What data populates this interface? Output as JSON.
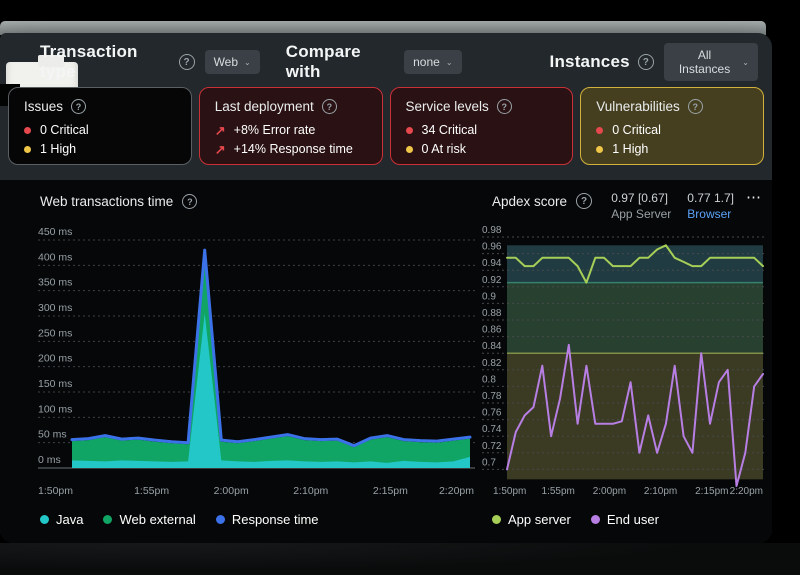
{
  "toolbar": {
    "transaction_type_label": "Transaction type",
    "transaction_type_value": "Web",
    "compare_with_label": "Compare with",
    "compare_with_value": "none",
    "instances_label": "Instances",
    "instances_value": "All Instances",
    "caret": "⌄",
    "help_glyph": "?"
  },
  "colors": {
    "critical": "#e5484d",
    "warning": "#f0c649",
    "link": "#5ba2f7"
  },
  "cards": [
    {
      "title": "Issues",
      "items": [
        {
          "text": "0 Critical",
          "color": "#e5484d"
        },
        {
          "text": "1 High",
          "color": "#f0c649"
        }
      ]
    },
    {
      "title": "Last deployment",
      "trend_glyph": "↗",
      "items": [
        {
          "text": "+8% Error rate",
          "color": "#e5484d"
        },
        {
          "text": "+14% Response time",
          "color": "#e5484d"
        }
      ]
    },
    {
      "title": "Service levels",
      "items": [
        {
          "text": "34 Critical",
          "color": "#e5484d"
        },
        {
          "text": "0 At risk",
          "color": "#f0c649"
        }
      ]
    },
    {
      "title": "Vulnerabilities",
      "items": [
        {
          "text": "0 Critical",
          "color": "#e5484d"
        },
        {
          "text": "1 High",
          "color": "#f0c649"
        }
      ]
    }
  ],
  "apdex_header": {
    "title": "Apdex score",
    "metrics": [
      {
        "value": "0.97 [0.67]",
        "label": "App Server"
      },
      {
        "value": "0.77 1.7]",
        "label": "Browser"
      }
    ],
    "more_glyph": "⋯"
  },
  "chart_data": [
    {
      "type": "area",
      "title": "Web transactions time",
      "x_labels": [
        "1:50pm",
        "1:55pm",
        "2:00pm",
        "2:10pm",
        "2:15pm",
        "2:20pm"
      ],
      "ylim": [
        0,
        450
      ],
      "ytick_step": 50,
      "y_unit": " ms",
      "grid": "dotted",
      "legend_position": "bottom",
      "stacked": true,
      "series": [
        {
          "name": "Java",
          "kind": "area",
          "color": "#23c7c7",
          "values": [
            15,
            14,
            13,
            15,
            14,
            13,
            12,
            13,
            305,
            15,
            13,
            12,
            14,
            15,
            13,
            12,
            13,
            11,
            13,
            10,
            14,
            12,
            11,
            13,
            22
          ]
        },
        {
          "name": "Web external",
          "kind": "area",
          "color": "#10a564",
          "values": [
            38,
            41,
            48,
            39,
            42,
            39,
            37,
            34,
            122,
            37,
            36,
            41,
            44,
            48,
            42,
            41,
            41,
            30,
            43,
            51,
            39,
            39,
            39,
            41,
            36
          ]
        },
        {
          "name": "Response time",
          "kind": "line",
          "color": "#3c72e9",
          "values": [
            56,
            58,
            64,
            57,
            59,
            55,
            52,
            50,
            430,
            55,
            52,
            56,
            61,
            66,
            58,
            56,
            57,
            44,
            59,
            64,
            56,
            54,
            53,
            57,
            61
          ]
        }
      ]
    },
    {
      "type": "line",
      "title": "Apdex score",
      "x_labels": [
        "1:50pm",
        "1:55pm",
        "2:00pm",
        "2:10pm",
        "2:15pm",
        "2:20pm"
      ],
      "ylim": [
        0.7,
        0.98
      ],
      "ytick_step": 0.02,
      "grid": "dotted",
      "legend_position": "bottom",
      "bands": [
        {
          "from": 0.925,
          "to": 0.97,
          "color": "#203c42"
        },
        {
          "from": 0.84,
          "to": 0.925,
          "color": "#28402f"
        },
        {
          "from": 0.688,
          "to": 0.84,
          "color": "#3b3a23"
        }
      ],
      "thresholds": [
        {
          "value": 0.925,
          "color": "#37816f"
        },
        {
          "value": 0.84,
          "color": "#7f9148"
        }
      ],
      "series": [
        {
          "name": "App server",
          "kind": "line",
          "color": "#a7cf58",
          "values": [
            0.955,
            0.955,
            0.945,
            0.945,
            0.955,
            0.955,
            0.955,
            0.955,
            0.945,
            0.925,
            0.955,
            0.955,
            0.945,
            0.945,
            0.945,
            0.955,
            0.955,
            0.965,
            0.97,
            0.955,
            0.95,
            0.945,
            0.945,
            0.955,
            0.955,
            0.955,
            0.955,
            0.955,
            0.955,
            0.945
          ]
        },
        {
          "name": "End user",
          "kind": "line",
          "color": "#b77fe3",
          "values": [
            0.7,
            0.745,
            0.765,
            0.775,
            0.825,
            0.74,
            0.785,
            0.85,
            0.755,
            0.825,
            0.755,
            0.755,
            0.755,
            0.758,
            0.805,
            0.72,
            0.765,
            0.72,
            0.755,
            0.825,
            0.74,
            0.72,
            0.84,
            0.755,
            0.805,
            0.82,
            0.68,
            0.72,
            0.8,
            0.815
          ]
        }
      ]
    }
  ]
}
